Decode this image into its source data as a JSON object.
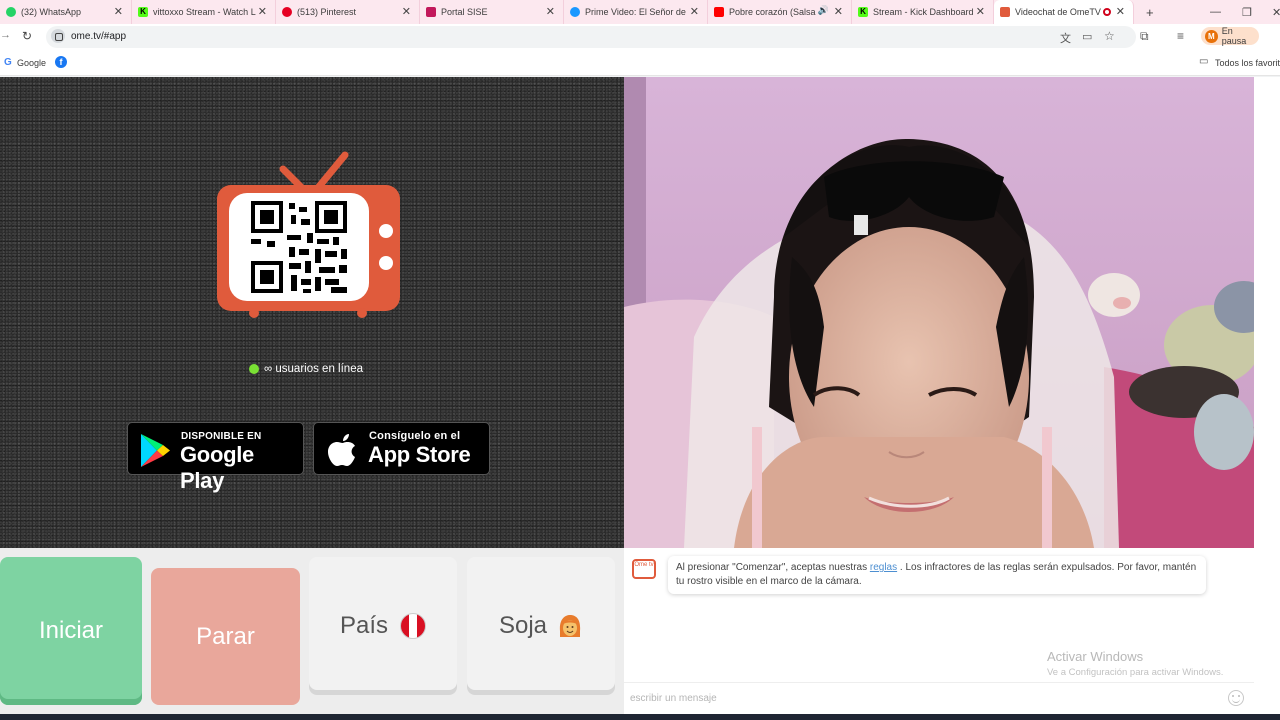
{
  "browser": {
    "tabs": [
      {
        "title": "(32) WhatsApp",
        "fav_color": "#25d366"
      },
      {
        "title": "vittoxxo Stream - Watch L",
        "fav_color": "#53fc18"
      },
      {
        "title": "(513) Pinterest",
        "fav_color": "#e60023"
      },
      {
        "title": "Portal SISE",
        "fav_color": "#c2185b"
      },
      {
        "title": "Prime Video: El Señor de",
        "fav_color": "#1a98ff"
      },
      {
        "title": "Pobre corazón (Salsa",
        "fav_color": "#ff0000"
      },
      {
        "title": "Stream - Kick Dashboard",
        "fav_color": "#53fc18"
      },
      {
        "title": "Videochat de OmeTV",
        "fav_color": "#e05b3c"
      }
    ],
    "new_tab": "+",
    "url": "ome.tv/#app",
    "profile": {
      "initial": "M",
      "label": "En pausa"
    },
    "bookmarks": {
      "google": "Google",
      "all_favorites": "Todos los favoritos"
    }
  },
  "page": {
    "online_text": "∞ usuarios en línea",
    "google_play": {
      "small": "DISPONIBLE EN",
      "big": "Google Play"
    },
    "app_store": {
      "small": "Consíguelo en el",
      "big": "App Store"
    },
    "buttons": {
      "start": "Iniciar",
      "stop": "Parar",
      "country": "País",
      "gender": "Soja"
    },
    "chat": {
      "logo_text": "Ome tv",
      "notice_before": "Al presionar \"Comenzar\", aceptas nuestras ",
      "notice_link": "reglas",
      "notice_after": " . Los infractores de las reglas serán expulsados. Por favor, mantén tu rostro visible en el marco de la cámara.",
      "input_placeholder": "escribir un mensaje"
    },
    "watermark": {
      "title": "Activar Windows",
      "subtitle": "Ve a Configuración para activar Windows."
    }
  },
  "colors": {
    "brand": "#e05b3c",
    "start": "#7ed3a2",
    "stop": "#e9a79b",
    "online_dot": "#7ae034"
  }
}
